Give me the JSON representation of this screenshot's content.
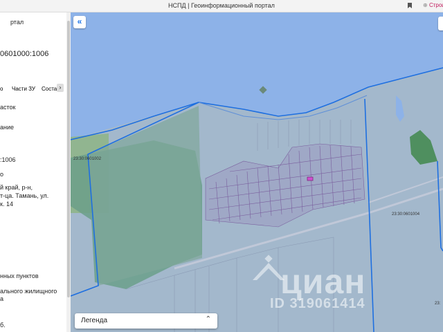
{
  "browser": {
    "title": "НСПД | Геоинформационный портал",
    "build_route": "Строи"
  },
  "panel": {
    "line1": "ртал",
    "cadastral_number": "0601000:1006",
    "tabs": [
      "о",
      "Части ЗУ",
      "Состав"
    ],
    "tab_more": "›",
    "line_type": "асток",
    "line_name": "ание",
    "cad_short": ":1006",
    "line_o": "о",
    "address_l1": "й край, р-н,",
    "address_l2": "т-ца. Тамань, ул.",
    "address_l3": "к. 14",
    "category": "нных пунктов",
    "use_l1": "ального жилищного",
    "use_l2": "а",
    "bottom": "б."
  },
  "map": {
    "label_left": "23:30:0601002",
    "label_right": "23:30:0601004",
    "label_edge": "23:",
    "legend_label": "Легенда",
    "watermark_brand": "циан",
    "watermark_id": "ID 319061414",
    "colors": {
      "sea": "#8db2e8",
      "parcel": "#a3b8cc",
      "green": "#6b9f8a",
      "border": "#1e6fe0",
      "street": "#7a5f9e"
    }
  }
}
